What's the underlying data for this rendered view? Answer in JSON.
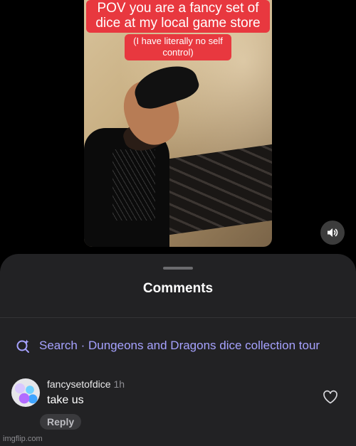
{
  "video": {
    "caption_main": "POV you are a fancy set of dice at my local game store",
    "caption_sub": "(I have literally no self control)",
    "sound_icon": "speaker-icon"
  },
  "comments_sheet": {
    "title": "Comments",
    "search_label": "Search · Dungeons and Dragons dice collection tour",
    "search_color": "#a6a2ff",
    "comment": {
      "username": "fancysetofdice",
      "time": "1h",
      "text": "take us",
      "reply_label": "Reply",
      "like_icon": "heart-icon"
    }
  },
  "watermark": "imgflip.com"
}
